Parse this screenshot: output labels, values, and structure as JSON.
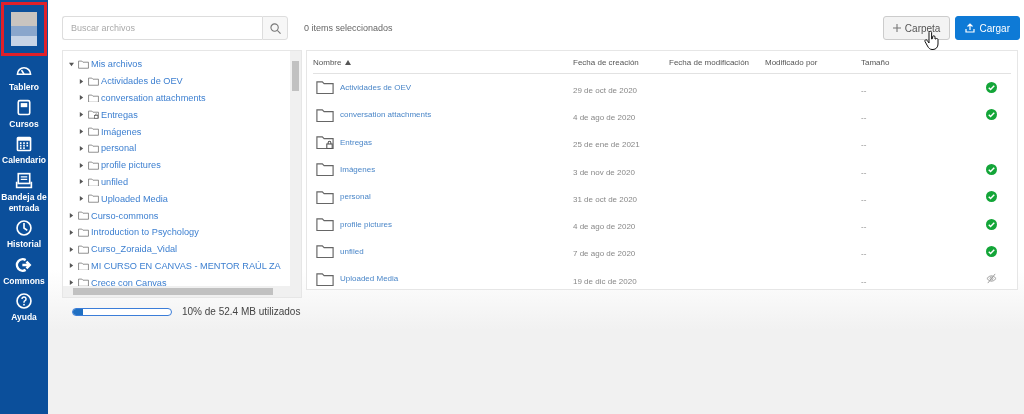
{
  "nav": {
    "items": [
      {
        "label": "Tablero",
        "kind": "dashboard",
        "selected": false
      },
      {
        "label": "Cursos",
        "kind": "courses",
        "selected": false
      },
      {
        "label": "Calendario",
        "kind": "calendar",
        "selected": false
      },
      {
        "label": "Bandeja de entrada",
        "kind": "inbox",
        "selected": false
      },
      {
        "label": "Historial",
        "kind": "history",
        "selected": false
      },
      {
        "label": "Commons",
        "kind": "commons",
        "selected": false
      },
      {
        "label": "Ayuda",
        "kind": "help",
        "selected": false
      }
    ]
  },
  "search": {
    "placeholder": "Buscar archivos"
  },
  "tree": [
    {
      "label": "Mis archivos",
      "kind": "folder",
      "expanded": true,
      "children": [
        {
          "label": "Actividades de OEV",
          "kind": "folder",
          "expanded": false
        },
        {
          "label": "conversation attachments",
          "kind": "folder",
          "expanded": false
        },
        {
          "label": "Entregas",
          "kind": "locked",
          "expanded": false
        },
        {
          "label": "Imágenes",
          "kind": "folder",
          "expanded": false
        },
        {
          "label": "personal",
          "kind": "folder",
          "expanded": false
        },
        {
          "label": "profile pictures",
          "kind": "folder",
          "expanded": false
        },
        {
          "label": "unfiled",
          "kind": "folder",
          "expanded": false
        },
        {
          "label": "Uploaded Media",
          "kind": "folder",
          "expanded": false
        }
      ]
    },
    {
      "label": "Curso-commons",
      "kind": "folder",
      "expanded": false
    },
    {
      "label": "Introduction to Psychology",
      "kind": "folder",
      "expanded": false
    },
    {
      "label": "Curso_Zoraida_Vidal",
      "kind": "folder",
      "expanded": false
    },
    {
      "label": "MI CURSO EN CANVAS - MENTOR RAÚL ZA",
      "kind": "folder",
      "expanded": false
    },
    {
      "label": "Crece con Canvas",
      "kind": "folder",
      "expanded": false
    }
  ],
  "storage": {
    "level": 0.1,
    "text": "10% de 52.4 MB utilizados"
  },
  "selection_count": "0 items seleccionados",
  "buttons": [
    {
      "label": "Carpeta",
      "kind": "add"
    },
    {
      "label": "Cargar",
      "kind": "upload"
    }
  ],
  "table": {
    "columns": [
      {
        "label": "Nombre",
        "sorted": true
      },
      {
        "label": "Fecha de creación",
        "sorted": false
      },
      {
        "label": "Fecha de modificación",
        "sorted": false
      },
      {
        "label": "Modificado por",
        "sorted": false
      },
      {
        "label": "Tamaño",
        "sorted": false
      }
    ],
    "rows": [
      {
        "name": "Actividades de OEV",
        "kind": "folder",
        "created": "29 de oct de 2020",
        "size": "--",
        "published": true,
        "hidden": false
      },
      {
        "name": "conversation attachments",
        "kind": "folder",
        "created": "4 de ago de 2020",
        "size": "--",
        "published": true,
        "hidden": false
      },
      {
        "name": "Entregas",
        "kind": "locked",
        "created": "25 de ene de 2021",
        "size": "--",
        "published": false,
        "hidden": false
      },
      {
        "name": "Imágenes",
        "kind": "folder",
        "created": "3 de nov de 2020",
        "size": "--",
        "published": true,
        "hidden": false
      },
      {
        "name": "personal",
        "kind": "folder",
        "created": "31 de oct de 2020",
        "size": "--",
        "published": true,
        "hidden": false
      },
      {
        "name": "profile pictures",
        "kind": "folder",
        "created": "4 de ago de 2020",
        "size": "--",
        "published": true,
        "hidden": false
      },
      {
        "name": "unfiled",
        "kind": "folder",
        "created": "7 de ago de 2020",
        "size": "--",
        "published": true,
        "hidden": false
      },
      {
        "name": "Uploaded Media",
        "kind": "folder",
        "created": "19 de dic de 2020",
        "size": "--",
        "published": false,
        "hidden": true
      }
    ]
  }
}
